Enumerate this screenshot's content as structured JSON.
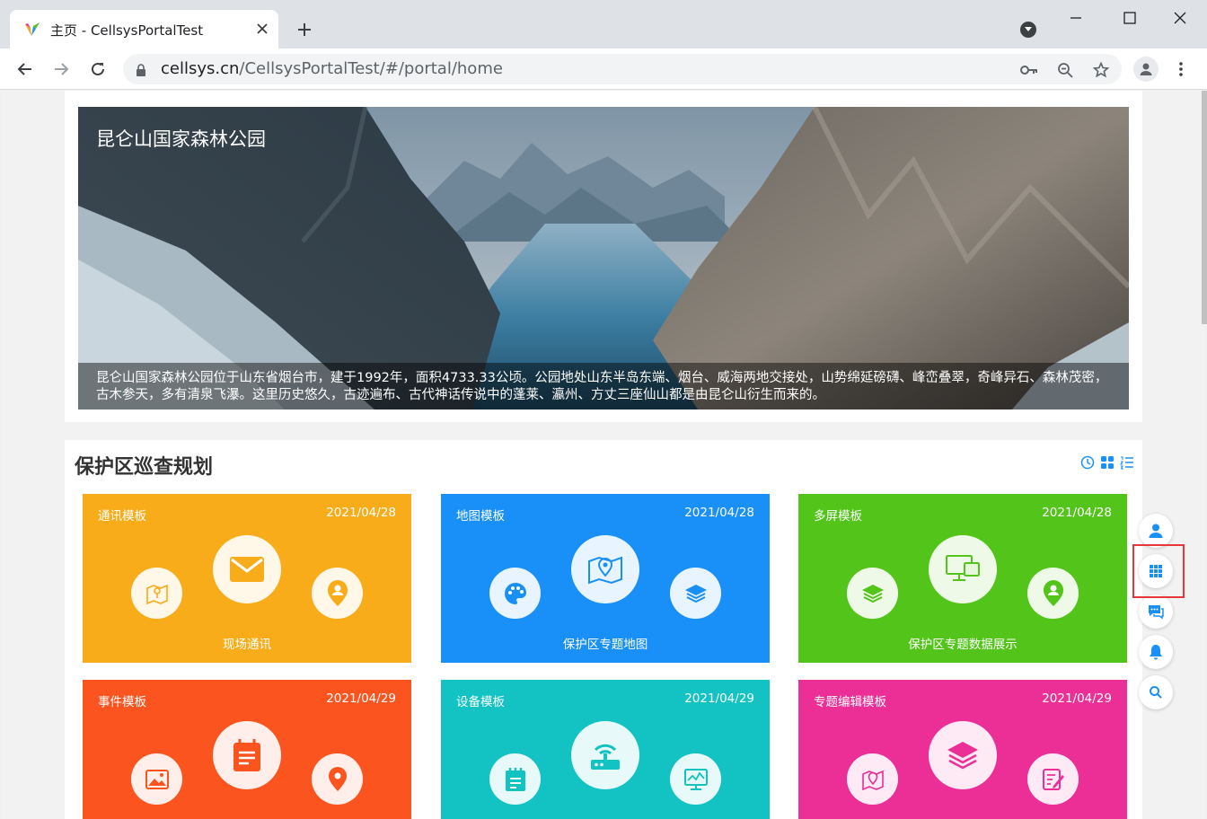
{
  "browser": {
    "tab_title": "主页 - CellsysPortalTest",
    "url_host": "cellsys.cn",
    "url_path": "/CellsysPortalTest/#/portal/home"
  },
  "banner": {
    "title": "昆仑山国家森林公园",
    "caption": "昆仑山国家森林公园位于山东省烟台市，建于1992年，面积4733.33公顷。公园地处山东半岛东端、烟台、威海两地交接处，山势绵延磅礴、峰峦叠翠，奇峰异石、森林茂密，古木参天，多有清泉飞瀑。这里历史悠久，古迹遍布、古代神话传说中的蓬莱、瀛州、方丈三座仙山都是由昆仑山衍生而来的。"
  },
  "plan": {
    "title": "保护区巡查规划",
    "cards": [
      {
        "name": "通讯模板",
        "date": "2021/04/28",
        "label": "现场通讯",
        "color": "#f9ac19",
        "icons": [
          "map-pin-icon",
          "envelope-icon",
          "user-location-icon"
        ]
      },
      {
        "name": "地图模板",
        "date": "2021/04/28",
        "label": "保护区专题地图",
        "color": "#1990f8",
        "icons": [
          "palette-icon",
          "map-pin-icon",
          "layers-icon"
        ]
      },
      {
        "name": "多屏模板",
        "date": "2021/04/28",
        "label": "保护区专题数据展示",
        "color": "#52c41a",
        "icons": [
          "layers-icon",
          "multi-screen-icon",
          "user-location-icon"
        ]
      },
      {
        "name": "事件模板",
        "date": "2021/04/29",
        "label": "",
        "color": "#fc541f",
        "icons": [
          "image-icon",
          "calendar-note-icon",
          "location-pin-icon"
        ]
      },
      {
        "name": "设备模板",
        "date": "2021/04/29",
        "label": "",
        "color": "#13c2c2",
        "icons": [
          "notepad-icon",
          "router-icon",
          "monitor-chart-icon"
        ]
      },
      {
        "name": "专题编辑模板",
        "date": "2021/04/29",
        "label": "",
        "color": "#eb2f96",
        "icons": [
          "map-pin-icon",
          "layers-icon",
          "edit-doc-icon"
        ]
      }
    ]
  },
  "side_toolbar": [
    "user-icon",
    "apps-grid-icon",
    "chat-icon",
    "bell-icon",
    "search-icon"
  ]
}
